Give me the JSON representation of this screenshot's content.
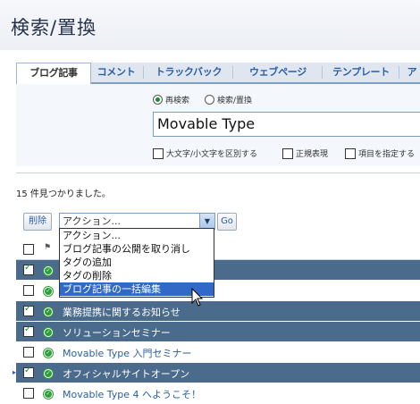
{
  "page": {
    "title": "検索/置換"
  },
  "tabs": [
    {
      "label": "ブログ記事",
      "active": true
    },
    {
      "label": "コメント"
    },
    {
      "label": "トラックバック"
    },
    {
      "label": "ウェブページ"
    },
    {
      "label": "テンプレート"
    },
    {
      "label": "ア"
    }
  ],
  "search": {
    "mode_search": "再検索",
    "mode_replace": "検索/置換",
    "query": "Movable Type",
    "options": [
      {
        "label": "大文字/小文字を区別する",
        "checked": false
      },
      {
        "label": "正規表現",
        "checked": false
      },
      {
        "label": "項目を指定する",
        "checked": false
      }
    ]
  },
  "results": {
    "count_text": "15 件見つかりました。"
  },
  "actions": {
    "delete_label": "削除",
    "selected_action": "アクション...",
    "go_label": "Go",
    "options": [
      "アクション...",
      "ブログ記事の公開を取り消し",
      "タグの追加",
      "タグの削除",
      "ブログ記事の一括編集"
    ],
    "highlighted_option": "ブログ記事の一括編集"
  },
  "rows": [
    {
      "title": "",
      "checked": true,
      "selected": true
    },
    {
      "title": "",
      "checked": false,
      "selected": false
    },
    {
      "title": "業務提携に関するお知らせ",
      "checked": true,
      "selected": true
    },
    {
      "title": "ソリューションセミナー",
      "checked": true,
      "selected": true
    },
    {
      "title": "Movable Type 入門セミナー",
      "checked": false,
      "selected": false
    },
    {
      "title": "オフィシャルサイトオープン",
      "checked": true,
      "selected": true
    },
    {
      "title": "Movable Type 4 へようこそ！",
      "checked": false,
      "selected": false
    }
  ],
  "colors": {
    "accent": "#2a5ea3",
    "selected_row": "#4b6b8c",
    "highlight": "#3169c6",
    "status_green": "#2e9e3a"
  }
}
